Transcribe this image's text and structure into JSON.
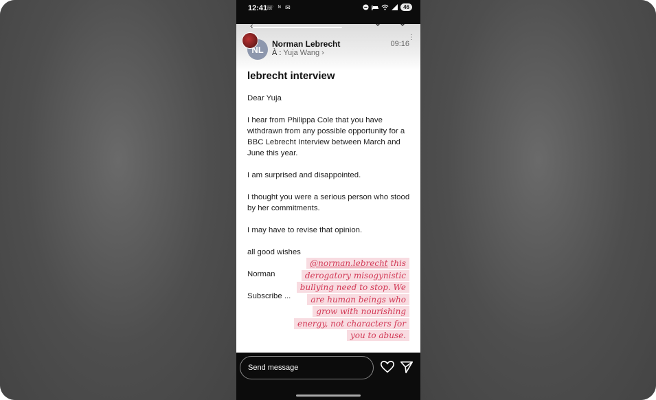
{
  "status_bar": {
    "time": "12:41",
    "icons": "☏ ᴺ ✉",
    "battery": "46"
  },
  "email": {
    "sender_initials": "NL",
    "sender": "Norman Lebrecht",
    "recipient_prefix": "À :",
    "recipient": "Yuja Wang",
    "time": "09:16",
    "subject": "lebrecht interview",
    "body": [
      "Dear Yuja",
      "I hear from Philippa Cole that you have withdrawn from any possible opportunity for a BBC Lebrecht Interview between March and June this year.",
      "I am surprised and disappointed.",
      "I thought you were a serious person who stood by her commitments.",
      "I may have to revise that opinion.",
      "all good wishes",
      "Norman",
      "Subscribe ..."
    ]
  },
  "sticker": {
    "mention": "@norman.lebrecht",
    "lines": [
      " this",
      "derogatory misogynistic",
      "bullying need to stop. We",
      "are human beings who",
      "grow with nourishing",
      "energy, not characters for",
      "you to abuse."
    ]
  },
  "reply_bar": {
    "placeholder": "Send message"
  },
  "colors": {
    "sticker_text": "#d23a57",
    "sticker_bg": "#f7d6dc",
    "avatar_nl": "#8d97ad"
  }
}
